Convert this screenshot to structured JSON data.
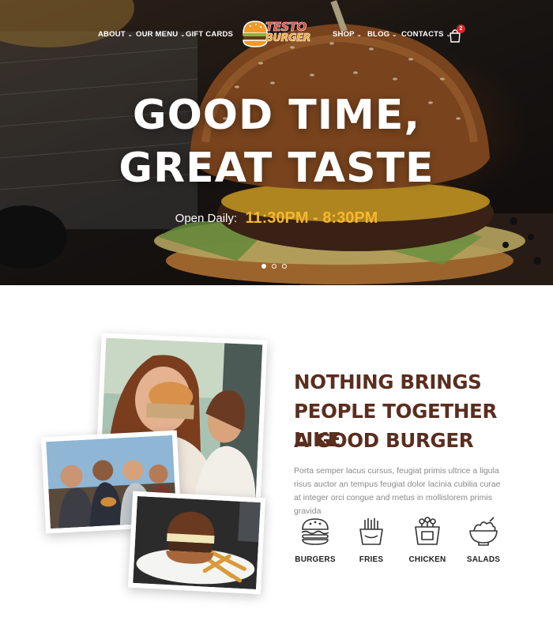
{
  "nav": {
    "left_items": [
      {
        "label": "ABOUT",
        "has_dropdown": true
      },
      {
        "label": "OUR MENU",
        "has_dropdown": true
      },
      {
        "label": "GIFT CARDS",
        "has_dropdown": false
      }
    ],
    "right_items": [
      {
        "label": "SHOP",
        "has_dropdown": true
      },
      {
        "label": "BLOG",
        "has_dropdown": true
      },
      {
        "label": "CONTACTS",
        "has_dropdown": true
      }
    ],
    "logo": {
      "line1": "TESTO",
      "line2": "BURGER"
    },
    "cart": {
      "icon": "shopping-bag-icon",
      "count": "2"
    }
  },
  "hero": {
    "title_line1": "GOOD TIME,",
    "title_line2": "GREAT TASTE",
    "hours_label": "Open Daily:",
    "hours_value": "11:30PM - 8:30PM",
    "slides_total": 3,
    "active_slide": 1
  },
  "about": {
    "headline_line1": "NOTHING BRINGS",
    "headline_line2": "PEOPLE TOGETHER LIKE",
    "headline_line3": "A GOOD BURGER",
    "body": "Porta semper lacus cursus, feugiat primis ultrice a ligula risus auctor an tempus feugiat dolor lacinia cubilia curae at integer orci congue and metus in mollislorem primis gravida"
  },
  "features": [
    {
      "label": "BURGERS",
      "icon": "burger-icon"
    },
    {
      "label": "FRIES",
      "icon": "fries-icon"
    },
    {
      "label": "CHICKEN",
      "icon": "chicken-bucket-icon"
    },
    {
      "label": "SALADS",
      "icon": "salad-bowl-icon"
    }
  ],
  "colors": {
    "accent": "#f5b82e",
    "headline": "#5a2e1f",
    "badge": "#d8262b",
    "body_text": "#8a8a8a"
  }
}
